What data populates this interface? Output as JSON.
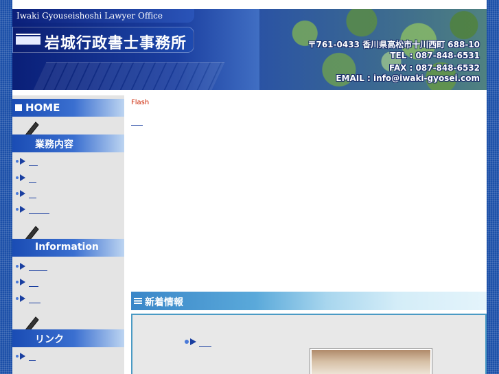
{
  "header": {
    "english_title": "Iwaki Gyouseishoshi Lawyer Office",
    "japanese_title": "岩城行政書士事務所",
    "address": "〒761-0433  香川県高松市十川西町 688-10",
    "tel": "TEL : 087-848-6531",
    "fax": "FAX : 087-848-6532",
    "email": "EMAIL : info@iwaki-gyosei.com"
  },
  "sidebar": {
    "home_label": "HOME",
    "sections": [
      {
        "title": "業務内容",
        "items": [
          "",
          "",
          "",
          ""
        ]
      },
      {
        "title": "Information",
        "items": [
          "",
          "",
          ""
        ]
      },
      {
        "title": "リンク",
        "items": [
          ""
        ]
      }
    ]
  },
  "main": {
    "flash_text": "Flash",
    "news_title": "新着情報"
  },
  "colors": {
    "background": "#1b4fa8",
    "nav_blue": "#1a4cb4",
    "link": "#1a3fa0",
    "flash_red": "#cc2200",
    "news_border": "#4a9ac4"
  },
  "icons": [
    "pen-icon",
    "arrow-bullet-icon",
    "square-bullet-icon",
    "list-lines-icon"
  ]
}
